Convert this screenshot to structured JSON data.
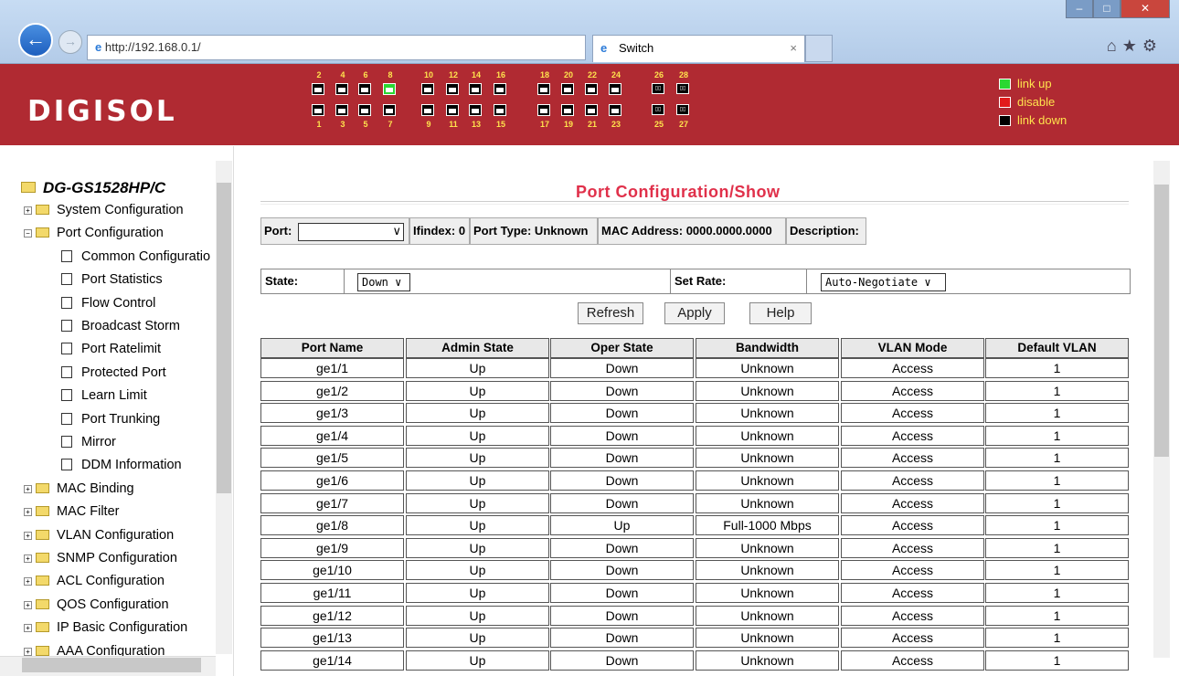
{
  "browser": {
    "url": "http://192.168.0.1/",
    "tab_title": "Switch",
    "back_symbol": "←",
    "forward_symbol": "→"
  },
  "header": {
    "logo": "DIGISOL",
    "ports_top": [
      "2",
      "4",
      "6",
      "8",
      "10",
      "12",
      "14",
      "16",
      "18",
      "20",
      "22",
      "24",
      "26",
      "28"
    ],
    "ports_bottom": [
      "1",
      "3",
      "5",
      "7",
      "9",
      "11",
      "13",
      "15",
      "17",
      "19",
      "21",
      "23",
      "25",
      "27"
    ],
    "port_up": "8",
    "legend": [
      {
        "label": "link up",
        "color": "#2ad832"
      },
      {
        "label": "disable",
        "color": "#e21b1b"
      },
      {
        "label": "link down",
        "color": "#000000"
      }
    ]
  },
  "sidebar": {
    "root": "DG-GS1528HP/C",
    "items": [
      {
        "label": "System Configuration",
        "kind": "folder",
        "expanded": false
      },
      {
        "label": "Port Configuration",
        "kind": "folder",
        "expanded": true
      },
      {
        "label": "Common Configuratio",
        "kind": "page"
      },
      {
        "label": "Port Statistics",
        "kind": "page"
      },
      {
        "label": "Flow Control",
        "kind": "page"
      },
      {
        "label": "Broadcast Storm",
        "kind": "page"
      },
      {
        "label": "Port Ratelimit",
        "kind": "page"
      },
      {
        "label": "Protected Port",
        "kind": "page"
      },
      {
        "label": "Learn Limit",
        "kind": "page"
      },
      {
        "label": "Port Trunking",
        "kind": "page"
      },
      {
        "label": "Mirror",
        "kind": "page"
      },
      {
        "label": "DDM Information",
        "kind": "page"
      },
      {
        "label": "MAC Binding",
        "kind": "folder",
        "expanded": false
      },
      {
        "label": "MAC Filter",
        "kind": "folder",
        "expanded": false
      },
      {
        "label": "VLAN Configuration",
        "kind": "folder",
        "expanded": false
      },
      {
        "label": "SNMP Configuration",
        "kind": "folder",
        "expanded": false
      },
      {
        "label": "ACL Configuration",
        "kind": "folder",
        "expanded": false
      },
      {
        "label": "QOS Configuration",
        "kind": "folder",
        "expanded": false
      },
      {
        "label": "IP Basic Configuration",
        "kind": "folder",
        "expanded": false
      },
      {
        "label": "AAA Configuration",
        "kind": "folder",
        "expanded": false
      }
    ]
  },
  "main": {
    "title": "Port Configuration/Show",
    "info": {
      "port_label": "Port:",
      "port_value": "",
      "ifindex": "Ifindex: 0",
      "port_type": "Port Type: Unknown",
      "mac": "MAC Address: 0000.0000.0000",
      "description": "Description:"
    },
    "state_label": "State:",
    "state_value": "Down",
    "rate_label": "Set Rate:",
    "rate_value": "Auto-Negotiate",
    "buttons": {
      "refresh": "Refresh",
      "apply": "Apply",
      "help": "Help"
    },
    "columns": [
      "Port Name",
      "Admin State",
      "Oper State",
      "Bandwidth",
      "VLAN Mode",
      "Default VLAN"
    ],
    "rows": [
      [
        "ge1/1",
        "Up",
        "Down",
        "Unknown",
        "Access",
        "1"
      ],
      [
        "ge1/2",
        "Up",
        "Down",
        "Unknown",
        "Access",
        "1"
      ],
      [
        "ge1/3",
        "Up",
        "Down",
        "Unknown",
        "Access",
        "1"
      ],
      [
        "ge1/4",
        "Up",
        "Down",
        "Unknown",
        "Access",
        "1"
      ],
      [
        "ge1/5",
        "Up",
        "Down",
        "Unknown",
        "Access",
        "1"
      ],
      [
        "ge1/6",
        "Up",
        "Down",
        "Unknown",
        "Access",
        "1"
      ],
      [
        "ge1/7",
        "Up",
        "Down",
        "Unknown",
        "Access",
        "1"
      ],
      [
        "ge1/8",
        "Up",
        "Up",
        "Full-1000 Mbps",
        "Access",
        "1"
      ],
      [
        "ge1/9",
        "Up",
        "Down",
        "Unknown",
        "Access",
        "1"
      ],
      [
        "ge1/10",
        "Up",
        "Down",
        "Unknown",
        "Access",
        "1"
      ],
      [
        "ge1/11",
        "Up",
        "Down",
        "Unknown",
        "Access",
        "1"
      ],
      [
        "ge1/12",
        "Up",
        "Down",
        "Unknown",
        "Access",
        "1"
      ],
      [
        "ge1/13",
        "Up",
        "Down",
        "Unknown",
        "Access",
        "1"
      ],
      [
        "ge1/14",
        "Up",
        "Down",
        "Unknown",
        "Access",
        "1"
      ]
    ]
  }
}
